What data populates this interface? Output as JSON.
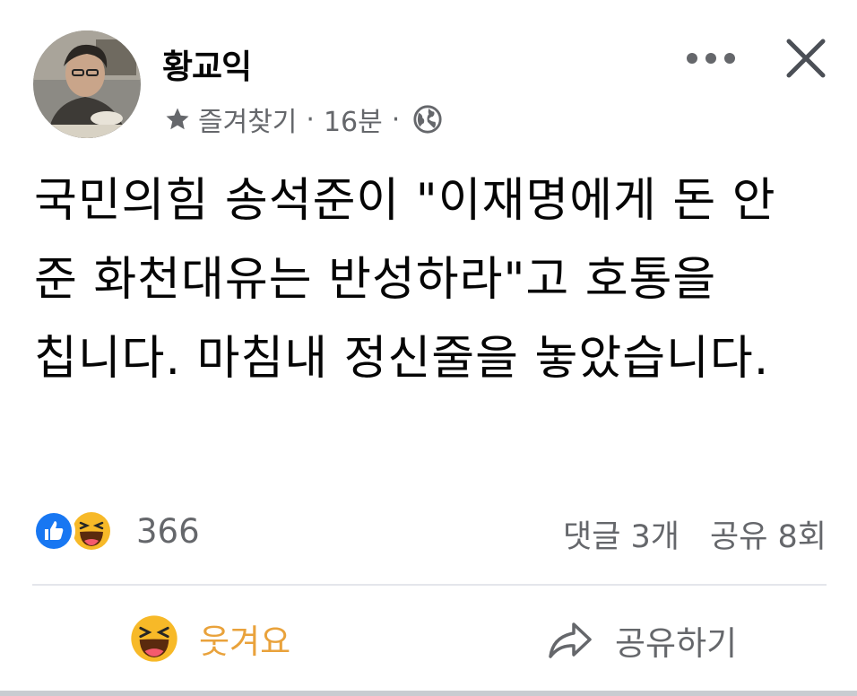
{
  "post": {
    "author": "황교익",
    "audience": "즐겨찾기",
    "separator": "·",
    "time": "16분",
    "text": "국민의힘 송석준이 \"이재명에게 돈 안 준 화천대유는 반성하라\"고 호통을 칩니다. 마침내 정신줄을 놓았습니다."
  },
  "icons": {
    "star": "star-icon",
    "globe": "globe-icon",
    "more": "more-icon",
    "close": "close-icon",
    "like": "like-reaction-icon",
    "haha": "haha-reaction-icon",
    "share": "share-icon"
  },
  "stats": {
    "reaction_count": "366",
    "comments": "댓글 3개",
    "shares": "공유 8회"
  },
  "actions": {
    "laugh_label": "웃겨요",
    "share_label": "공유하기"
  },
  "colors": {
    "like_blue": "#1877f2",
    "haha_yellow": "#f7b928",
    "laugh_label": "#e9a23b",
    "secondary_text": "#65676b"
  }
}
